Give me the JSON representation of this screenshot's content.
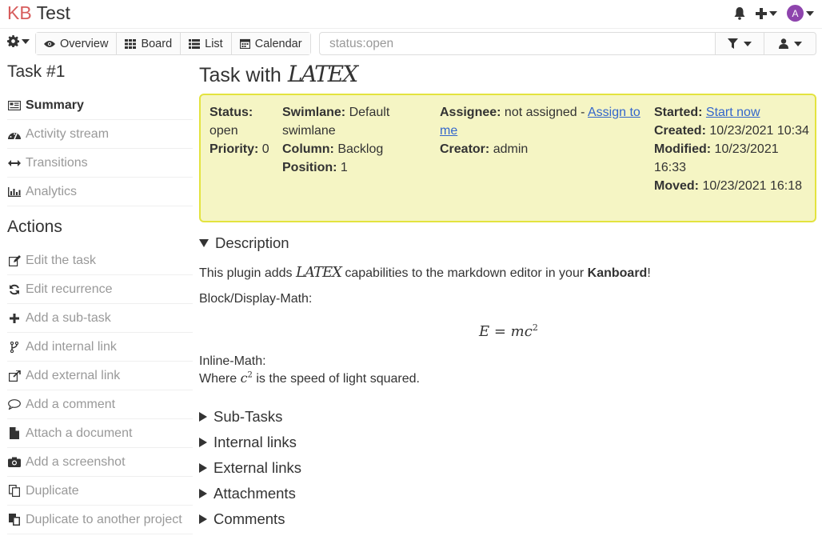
{
  "header": {
    "logo_kb": "KB",
    "project_title": "Test",
    "avatar_letter": "A",
    "colors": {
      "logo_kb": "#d75c5c",
      "avatar": "#8e44ad",
      "summary_bg": "#f5f5c4",
      "summary_border": "#e3e33f",
      "link": "#3366CC"
    }
  },
  "toolbar": {
    "views": [
      {
        "label": "Overview",
        "icon": "eye-icon"
      },
      {
        "label": "Board",
        "icon": "board-icon"
      },
      {
        "label": "List",
        "icon": "list-icon"
      },
      {
        "label": "Calendar",
        "icon": "calendar-icon"
      }
    ],
    "search_value": "status:open"
  },
  "sidebar": {
    "task_title": "Task #1",
    "nav": [
      {
        "label": "Summary",
        "icon": "summary-icon"
      },
      {
        "label": "Activity stream",
        "icon": "dashboard-icon"
      },
      {
        "label": "Transitions",
        "icon": "arrows-h-icon"
      },
      {
        "label": "Analytics",
        "icon": "bar-chart-icon"
      }
    ],
    "actions_title": "Actions",
    "actions": [
      {
        "label": "Edit the task",
        "icon": "edit-icon"
      },
      {
        "label": "Edit recurrence",
        "icon": "refresh-icon"
      },
      {
        "label": "Add a sub-task",
        "icon": "plus-icon"
      },
      {
        "label": "Add internal link",
        "icon": "code-fork-icon"
      },
      {
        "label": "Add external link",
        "icon": "external-link-icon"
      },
      {
        "label": "Add a comment",
        "icon": "comment-icon"
      },
      {
        "label": "Attach a document",
        "icon": "file-icon"
      },
      {
        "label": "Add a screenshot",
        "icon": "camera-icon"
      },
      {
        "label": "Duplicate",
        "icon": "files-icon"
      },
      {
        "label": "Duplicate to another project",
        "icon": "clipboard-icon"
      }
    ]
  },
  "task": {
    "title_prefix": "Task with",
    "title_latex": "LATEX",
    "status_label": "Status:",
    "status_value": "open",
    "priority_label": "Priority:",
    "priority_value": "0",
    "swimlane_label": "Swimlane:",
    "swimlane_value": "Default swimlane",
    "column_label": "Column:",
    "column_value": "Backlog",
    "position_label": "Position:",
    "position_value": "1",
    "assignee_label": "Assignee:",
    "assignee_value": "not assigned -",
    "assign_link": "Assign to me",
    "creator_label": "Creator:",
    "creator_value": "admin",
    "started_label": "Started:",
    "start_link": "Start now",
    "created_label": "Created:",
    "created_value": "10/23/2021 10:34",
    "modified_label": "Modified:",
    "modified_value": "10/23/2021 16:33",
    "moved_label": "Moved:",
    "moved_value": "10/23/2021 16:18"
  },
  "description": {
    "heading": "Description",
    "line1_pre": "This plugin adds",
    "line1_latex": "LATEX",
    "line1_mid": "capabilities to the markdown editor in your",
    "line1_bold": "Kanboard",
    "line1_end": "!",
    "block_label": "Block/Display-Math:",
    "formula": "E = mc²",
    "inline_label": "Inline-Math:",
    "inline_pre": "Where",
    "inline_math": "c²",
    "inline_post": "is the speed of light squared."
  },
  "sections": [
    "Sub-Tasks",
    "Internal links",
    "External links",
    "Attachments",
    "Comments"
  ]
}
